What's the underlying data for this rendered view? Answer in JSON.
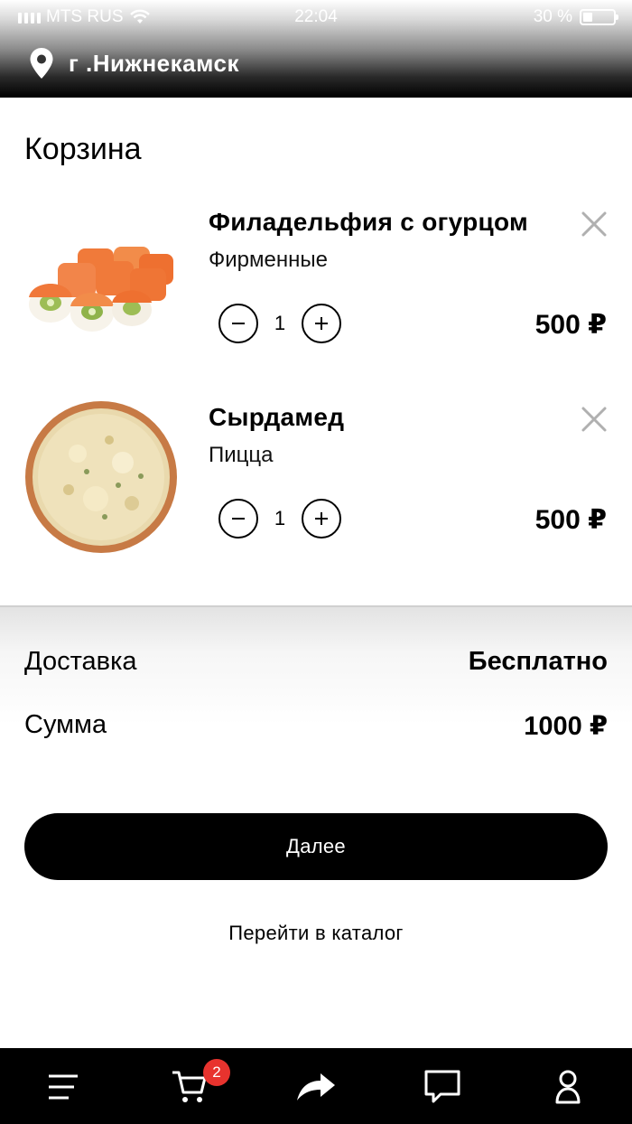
{
  "status_bar": {
    "carrier": "MTS RUS",
    "time": "22:04",
    "battery_percent": "30 %",
    "battery_level": 0.3
  },
  "header": {
    "city": "г .Нижнекамск",
    "location_icon": "location-pin-icon"
  },
  "page": {
    "title": "Корзина"
  },
  "cart_items": [
    {
      "name": "Филадельфия с огурцом",
      "category": "Фирменные",
      "quantity": "1",
      "price": "500 ₽",
      "image": "sushi-roll-image"
    },
    {
      "name": "Сырдамед",
      "category": "Пицца",
      "quantity": "1",
      "price": "500 ₽",
      "image": "pizza-image"
    }
  ],
  "summary": {
    "delivery_label": "Доставка",
    "delivery_value": "Бесплатно",
    "total_label": "Сумма",
    "total_value": "1000 ₽"
  },
  "buttons": {
    "next_label": "Далее",
    "catalog_link": "Перейти в каталог"
  },
  "tabbar": {
    "items": [
      "menu-icon",
      "cart-icon",
      "share-icon",
      "chat-icon",
      "profile-icon"
    ],
    "cart_badge": "2",
    "badge_color": "#e8332e"
  }
}
